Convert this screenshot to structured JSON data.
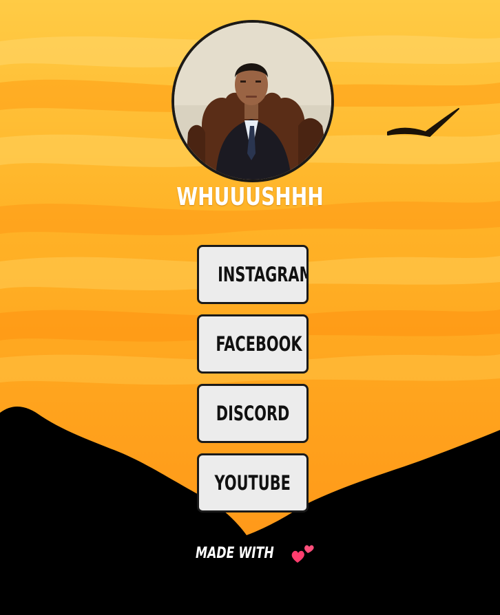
{
  "profile": {
    "username": "WHUUUSHHH",
    "avatar": "profile-photo"
  },
  "links": [
    {
      "label": "INSTAGRAM"
    },
    {
      "label": "FACEBOOK"
    },
    {
      "label": "DISCORD"
    },
    {
      "label": "YOUTUBE"
    }
  ],
  "footer": {
    "text": "MADE WITH",
    "icon": "two-hearts-icon"
  },
  "colors": {
    "sky_top": "#ffd04a",
    "sky_mid": "#ffb020",
    "sky_bottom": "#ff9a1a",
    "mountain": "#000000",
    "button_bg": "#ececec",
    "button_border": "#1a1a1a",
    "heart": "#ff3d6e"
  }
}
